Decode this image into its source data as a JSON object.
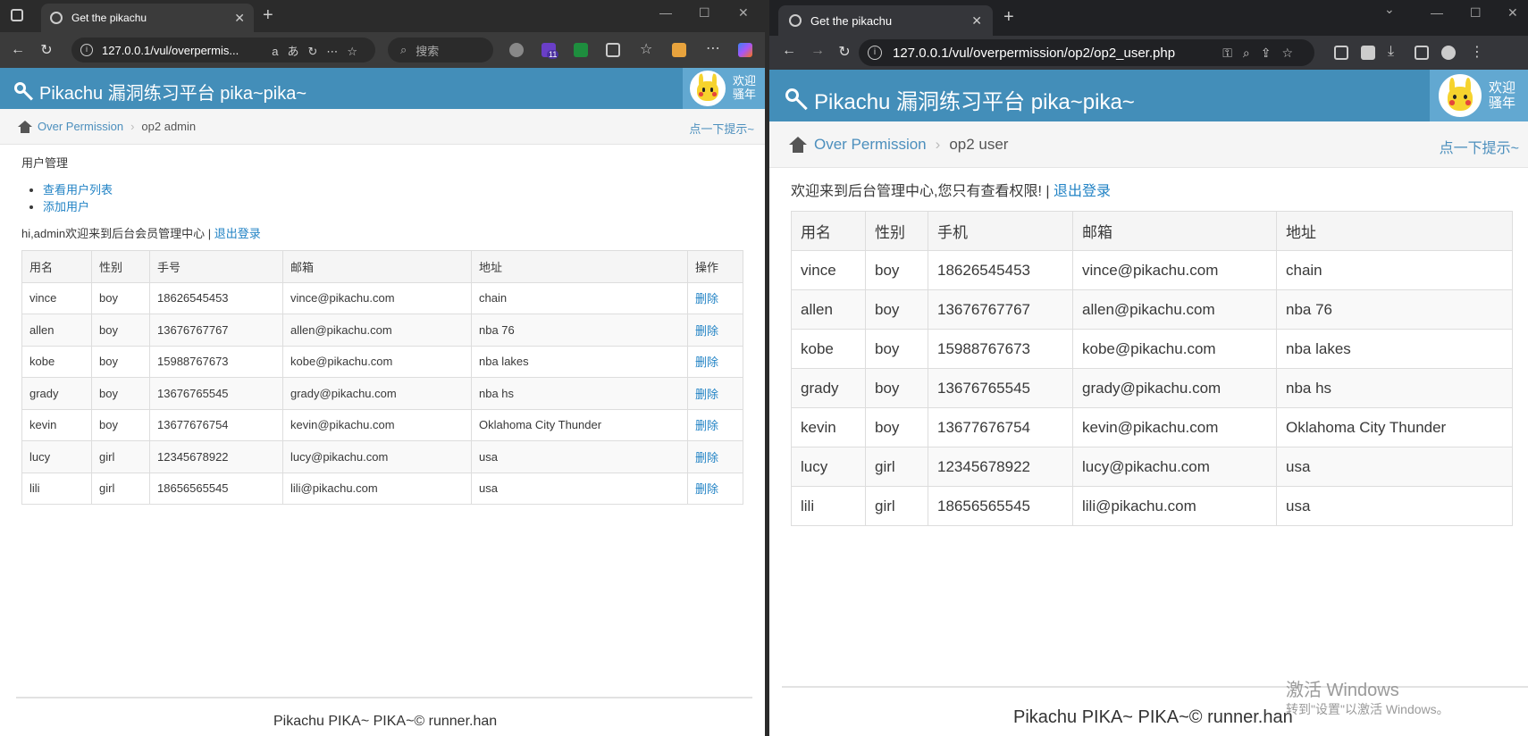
{
  "left": {
    "tab_title": "Get the pikachu",
    "url": "127.0.0.1/vul/overpermis...",
    "search_placeholder": "搜索",
    "ext_badge": "11",
    "site_title": "Pikachu 漏洞练习平台 pika~pika~",
    "welcome": [
      "欢迎",
      "骚年"
    ],
    "breadcrumb": {
      "link": "Over Permission",
      "current": "op2 admin"
    },
    "hint": "点一下提示~",
    "section_title": "用户管理",
    "menu": [
      "查看用户列表",
      "添加用户"
    ],
    "greeting": "hi,admin欢迎来到后台会员管理中心 | ",
    "logout": "退出登录",
    "columns": [
      "用名",
      "性别",
      "手号",
      "邮箱",
      "地址",
      "操作"
    ],
    "delete_label": "删除",
    "footer": "Pikachu PIKA~ PIKA~© runner.han"
  },
  "right": {
    "tab_title": "Get the pikachu",
    "url": "127.0.0.1/vul/overpermission/op2/op2_user.php",
    "site_title": "Pikachu 漏洞练习平台 pika~pika~",
    "welcome": [
      "欢迎",
      "骚年"
    ],
    "breadcrumb": {
      "link": "Over Permission",
      "current": "op2 user"
    },
    "hint": "点一下提示~",
    "greeting": "欢迎来到后台管理中心,您只有查看权限! | ",
    "logout": "退出登录",
    "columns": [
      "用名",
      "性别",
      "手机",
      "邮箱",
      "地址"
    ],
    "footer": "Pikachu PIKA~ PIKA~© runner.han",
    "watermark": [
      "激活 Windows",
      "转到\"设置\"以激活 Windows。"
    ]
  },
  "users": [
    {
      "name": "vince",
      "sex": "boy",
      "phone": "18626545453",
      "email": "vince@pikachu.com",
      "address": "chain"
    },
    {
      "name": "allen",
      "sex": "boy",
      "phone": "13676767767",
      "email": "allen@pikachu.com",
      "address": "nba 76"
    },
    {
      "name": "kobe",
      "sex": "boy",
      "phone": "15988767673",
      "email": "kobe@pikachu.com",
      "address": "nba lakes"
    },
    {
      "name": "grady",
      "sex": "boy",
      "phone": "13676765545",
      "email": "grady@pikachu.com",
      "address": "nba hs"
    },
    {
      "name": "kevin",
      "sex": "boy",
      "phone": "13677676754",
      "email": "kevin@pikachu.com",
      "address": "Oklahoma City Thunder"
    },
    {
      "name": "lucy",
      "sex": "girl",
      "phone": "12345678922",
      "email": "lucy@pikachu.com",
      "address": "usa"
    },
    {
      "name": "lili",
      "sex": "girl",
      "phone": "18656565545",
      "email": "lili@pikachu.com",
      "address": "usa"
    }
  ]
}
